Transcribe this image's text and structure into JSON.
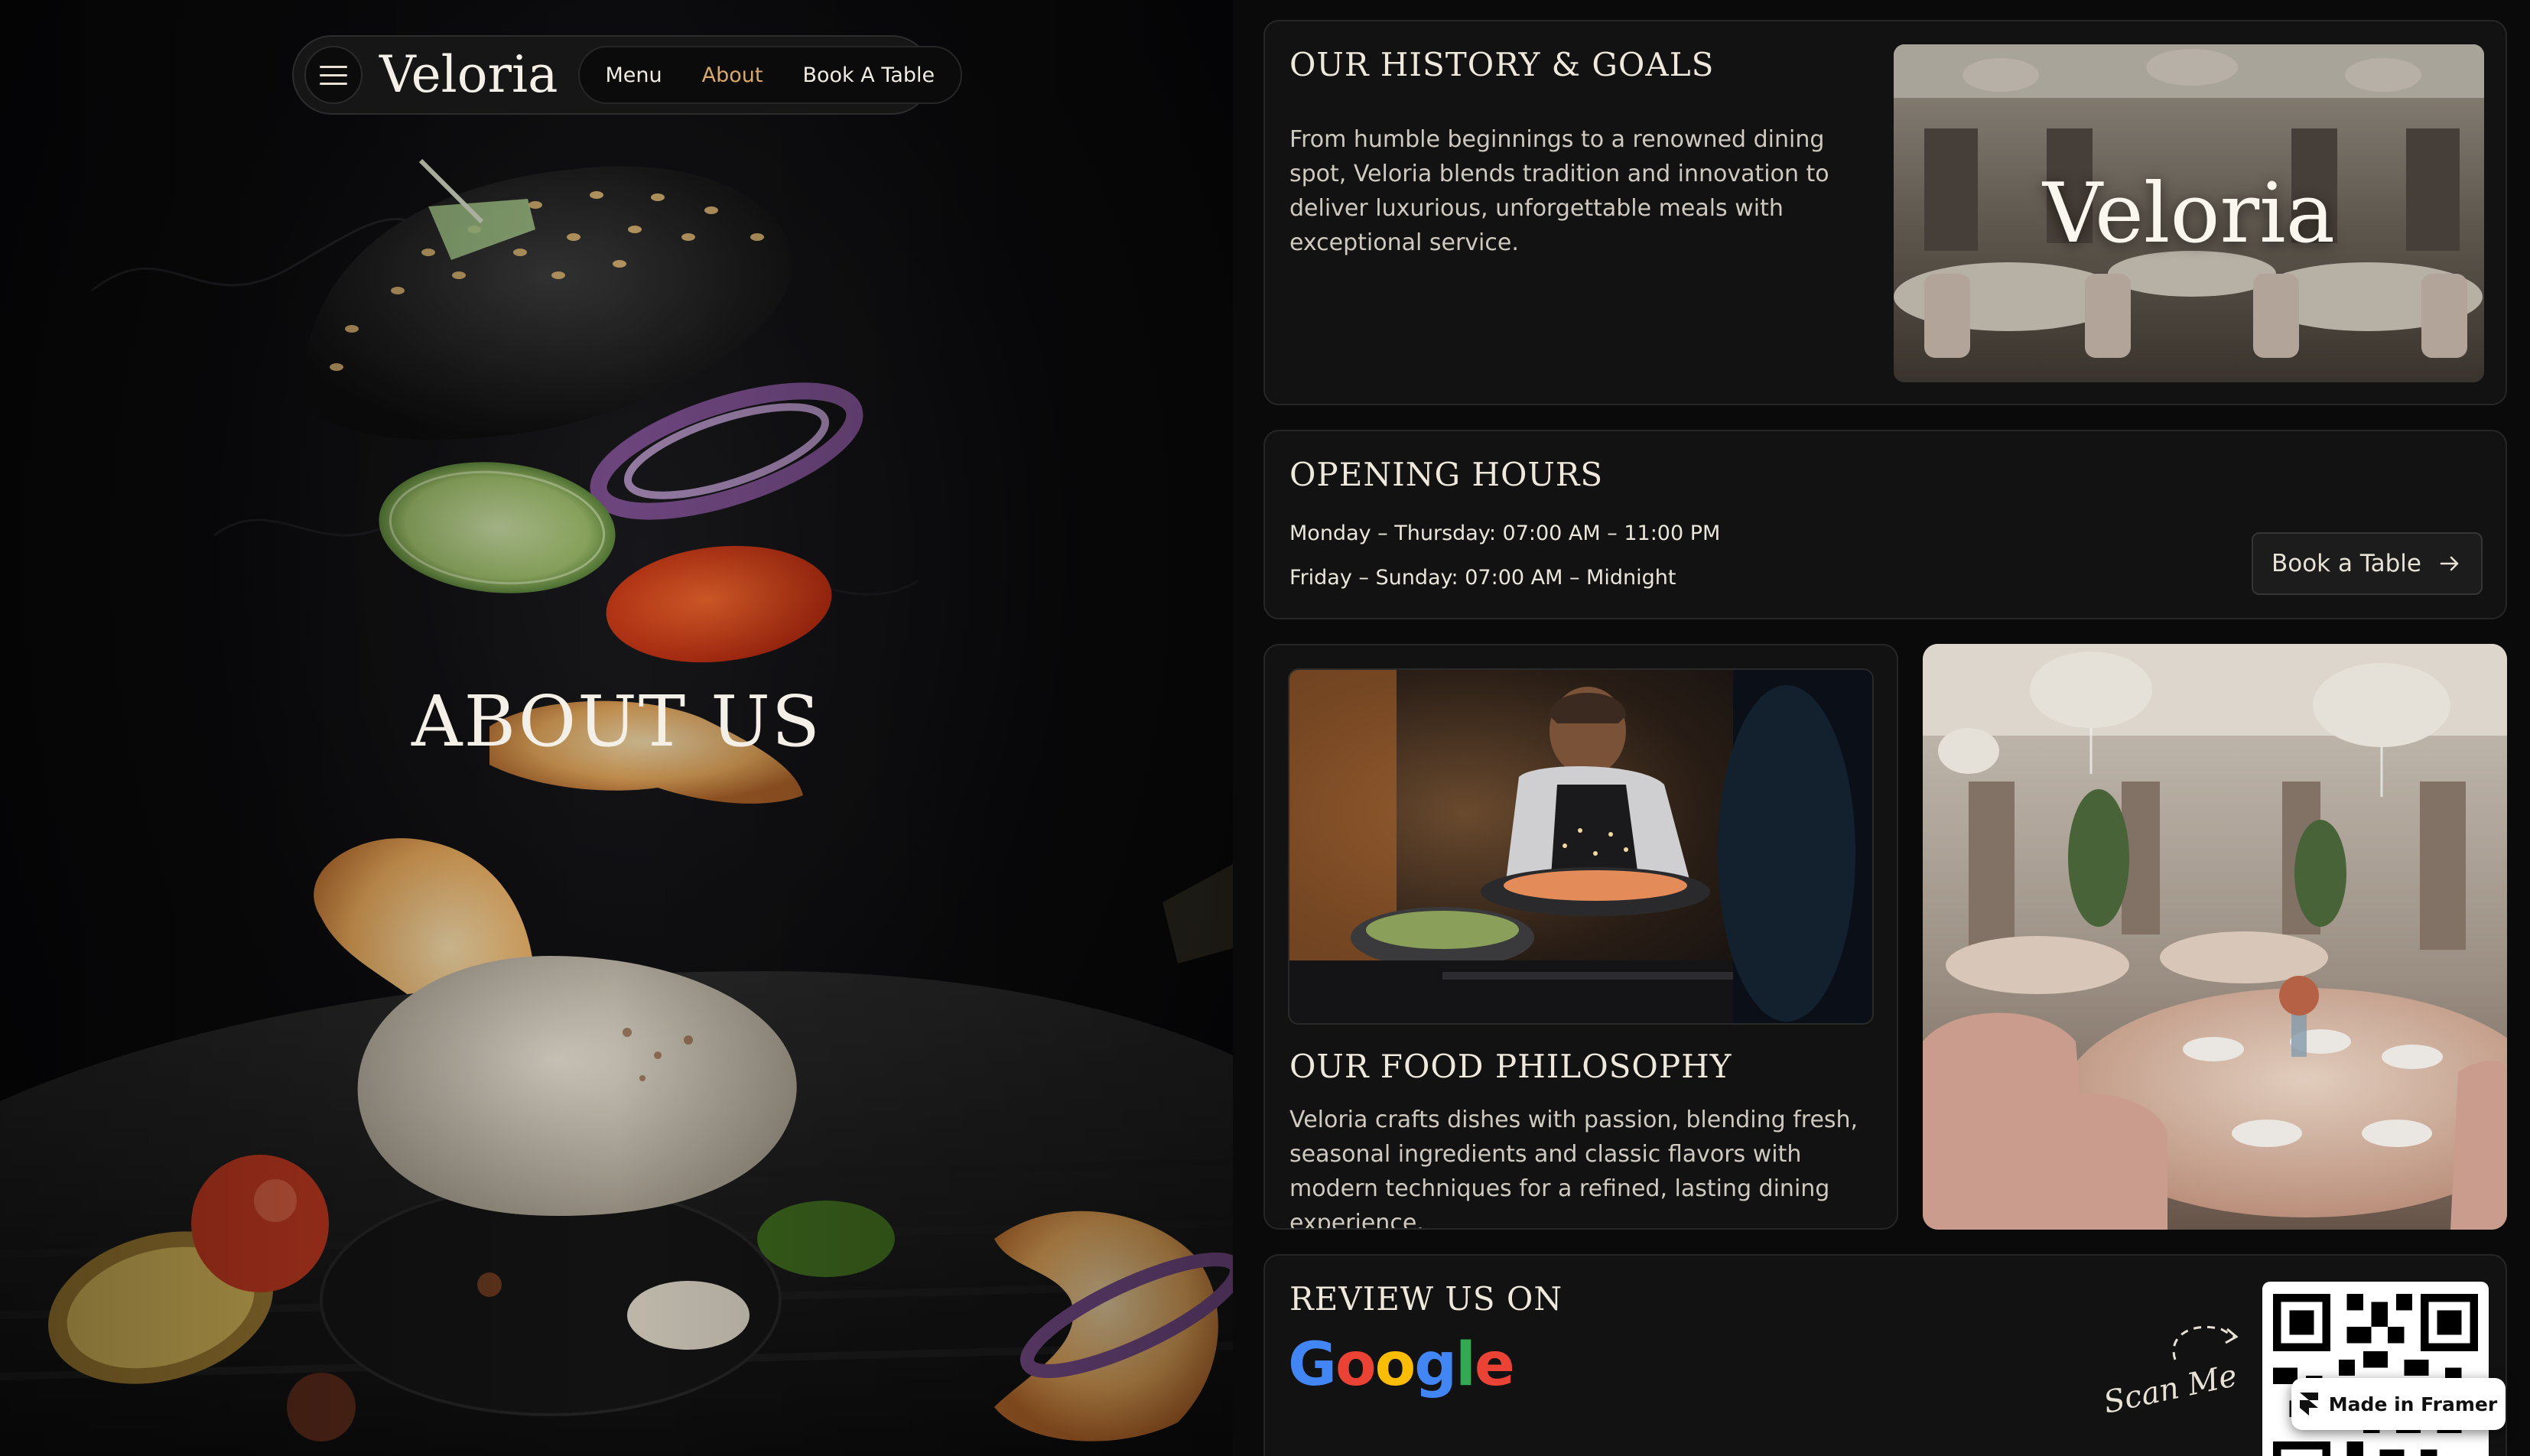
{
  "brand": {
    "name": "Veloria"
  },
  "nav": {
    "items": [
      {
        "label": "Menu",
        "active": false
      },
      {
        "label": "About",
        "active": true
      },
      {
        "label": "Book A Table",
        "active": false
      }
    ],
    "active_color": "#d8a86c"
  },
  "hero": {
    "title": "ABOUT US"
  },
  "history": {
    "title": "OUR HISTORY & GOALS",
    "text": "From humble beginnings to a renowned dining spot, Veloria blends tradition and innovation to deliver luxurious, unforgettable meals with exceptional service.",
    "image_overlay": "Veloria"
  },
  "hours": {
    "title": "OPENING HOURS",
    "lines": [
      "Monday – Thursday: 07:00 AM – 11:00 PM",
      "Friday – Sunday: 07:00 AM – Midnight"
    ],
    "button_label": "Book a Table"
  },
  "philosophy": {
    "title": "OUR FOOD PHILOSOPHY",
    "text": "Veloria crafts dishes with passion, blending fresh, seasonal ingredients and classic flavors with modern techniques for a refined, lasting dining experience."
  },
  "review": {
    "title": "REVIEW US ON",
    "google": "Google",
    "scan_label": "Scan Me"
  },
  "badge": {
    "label": "Made in Framer"
  },
  "colors": {
    "background": "#0a0a0a",
    "card": "#121212",
    "accent": "#d8a86c",
    "google_blue": "#4285F4",
    "google_red": "#EA4335",
    "google_yellow": "#FBBC05",
    "google_green": "#34A853"
  }
}
